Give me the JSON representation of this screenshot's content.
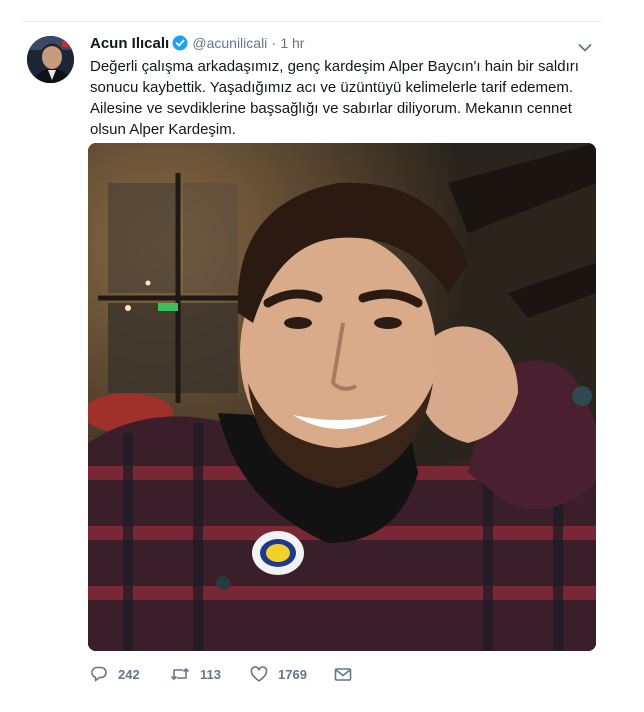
{
  "tweet": {
    "author_name": "Acun Ilıcalı",
    "author_handle": "@acunilicali",
    "separator": "·",
    "timestamp": "1 hr",
    "text": "Değerli çalışma arkadaşımız, genç kardeşim Alper Baycın'ı hain bir saldırı sonucu kaybettik. Yaşadığımız acı ve üzüntüyü kelimelerle tarif edemem. Ailesine ve sevdiklerine başsağlığı ve sabırlar diliyorum. Mekanın cennet olsun Alper Kardeşim.",
    "verified": true
  },
  "actions": {
    "replies": "242",
    "retweets": "113",
    "likes": "1769"
  },
  "colors": {
    "verified_blue": "#1da1f2",
    "icon_gray": "#657786",
    "retweet_green": "#17bf63"
  },
  "icons": {
    "reply": "reply-icon",
    "retweet": "retweet-icon",
    "like": "heart-icon",
    "dm": "envelope-icon",
    "caret": "chevron-down-icon",
    "verified": "verified-badge-icon"
  }
}
